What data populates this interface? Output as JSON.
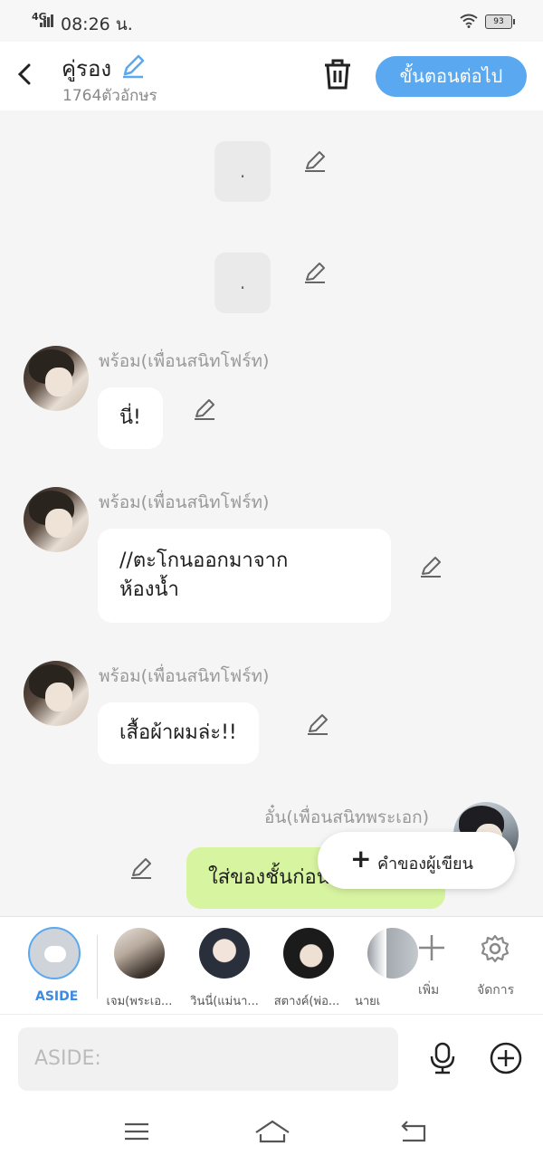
{
  "status": {
    "network": "4G",
    "time": "08:26 น.",
    "battery": "93"
  },
  "header": {
    "title": "คู่รอง",
    "subtitle": "1764ตัวอักษร",
    "next_label": "ขั้นตอนต่อไป"
  },
  "messages": [
    {
      "text": "."
    },
    {
      "text": "."
    },
    {
      "name": "พร้อม(เพื่อนสนิทโฟร์ท)",
      "text": "นี่!"
    },
    {
      "name": "พร้อม(เพื่อนสนิทโฟร์ท)",
      "text_line1": "//ตะโกนออกมาจาก",
      "text_line2": "ห้องน้ำ"
    },
    {
      "name": "พร้อม(เพื่อนสนิทโฟร์ท)",
      "text": "เสื้อผ้าผมล่ะ!!"
    },
    {
      "name": "อั๋น(เพื่อนสนิทพระเอก)",
      "text": "ใส่ของชั้นก่อน"
    }
  ],
  "fab": {
    "label": "คำของผู้เขียน"
  },
  "characters": {
    "aside": "ASIDE",
    "items": [
      {
        "name": "เจม(พระเอ..."
      },
      {
        "name": "วินนี่(แม่นา..."
      },
      {
        "name": "สตางค์(พ่อ..."
      },
      {
        "name": "นายเ"
      }
    ],
    "add_label": "เพิ่ม",
    "manage_label": "จัดการ"
  },
  "input": {
    "placeholder": "ASIDE:"
  },
  "colors": {
    "accent": "#5aa9f0",
    "bubble_right": "#d7f4a0",
    "background": "#f5f5f5"
  }
}
